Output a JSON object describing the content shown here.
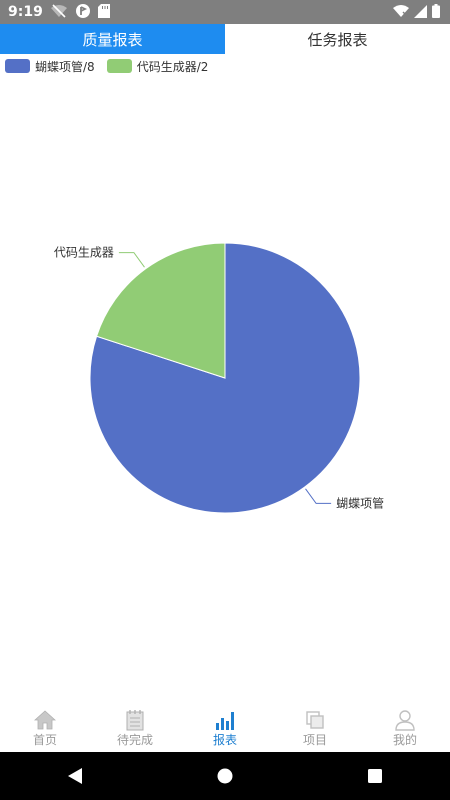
{
  "status_bar": {
    "time": "9:19",
    "left_icons": [
      "wifi-off-icon",
      "app-notification-icon",
      "sd-card-icon"
    ],
    "right_icons": [
      "wifi-signal-icon",
      "cell-signal-icon",
      "battery-icon"
    ]
  },
  "tabs": [
    {
      "label": "质量报表",
      "active": true
    },
    {
      "label": "任务报表",
      "active": false
    }
  ],
  "legend": [
    {
      "label": "蝴蝶项管/8",
      "color": "#5470c6"
    },
    {
      "label": "代码生成器/2",
      "color": "#91cc75"
    }
  ],
  "chart_data": {
    "type": "pie",
    "categories": [
      "蝴蝶项管",
      "代码生成器"
    ],
    "values": [
      8,
      2
    ],
    "colors": [
      "#5470c6",
      "#91cc75"
    ],
    "legend_entries": [
      "蝴蝶项管/8",
      "代码生成器/2"
    ],
    "legend_position": "top-left"
  },
  "bottom_nav": [
    {
      "label": "首页",
      "icon": "home-icon",
      "active": false
    },
    {
      "label": "待完成",
      "icon": "notepad-icon",
      "active": false
    },
    {
      "label": "报表",
      "icon": "bar-chart-icon",
      "active": true
    },
    {
      "label": "项目",
      "icon": "project-icon",
      "active": false
    },
    {
      "label": "我的",
      "icon": "person-icon",
      "active": false
    }
  ],
  "system_nav": [
    "back-icon",
    "home-circle-icon",
    "recents-icon"
  ]
}
